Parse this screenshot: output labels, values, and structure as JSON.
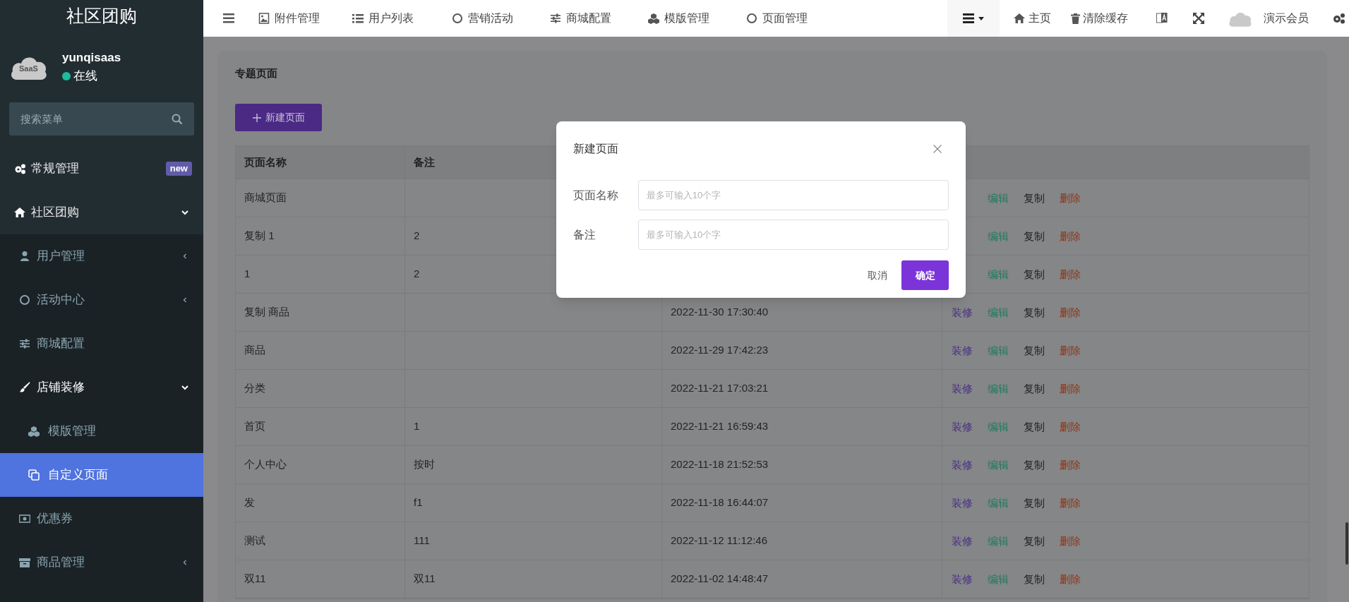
{
  "sidebar": {
    "title": "社区团购",
    "user": {
      "avatar_text": "SaaS",
      "name": "yunqisaas",
      "status": "在线",
      "online": true
    },
    "search": {
      "placeholder": "搜索菜单"
    },
    "menu": [
      {
        "label": "常规管理",
        "badge": "new",
        "selected": false
      },
      {
        "label": "社区团购",
        "expanded": true,
        "selected": false,
        "children": [
          {
            "label": "用户管理",
            "expanded": false,
            "selected": false
          },
          {
            "label": "活动中心",
            "expanded": false,
            "selected": false
          },
          {
            "label": "商城配置",
            "selected": false
          },
          {
            "label": "店铺装修",
            "expanded": true,
            "selected": false,
            "children": [
              {
                "label": "模版管理",
                "selected": false
              },
              {
                "label": "自定义页面",
                "selected": true
              }
            ]
          },
          {
            "label": "优惠券",
            "selected": false
          },
          {
            "label": "商品管理",
            "expanded": false,
            "selected": false
          }
        ]
      }
    ]
  },
  "topbar": {
    "nav": [
      "附件管理",
      "用户列表",
      "营销活动",
      "商城配置",
      "模版管理",
      "页面管理"
    ],
    "home": "主页",
    "clear_cache": "清除缓存",
    "user": "演示会员"
  },
  "content": {
    "title": "专题页面",
    "new_button": "新建页面",
    "table": {
      "columns": [
        "页面名称",
        "备注"
      ],
      "rows": [
        {
          "name": "商城页面",
          "actions": [
            {
              "kind": "edit",
              "label": "编辑"
            },
            {
              "kind": "copy",
              "label": "复制"
            },
            {
              "kind": "delete",
              "label": "删除"
            }
          ]
        },
        {
          "name": "复制 1",
          "note": "2",
          "actions": [
            {
              "kind": "edit",
              "label": "编辑"
            },
            {
              "kind": "copy",
              "label": "复制"
            },
            {
              "kind": "delete",
              "label": "删除"
            }
          ]
        },
        {
          "name": "1",
          "note": "2",
          "actions": [
            {
              "kind": "edit",
              "label": "编辑"
            },
            {
              "kind": "copy",
              "label": "复制"
            },
            {
              "kind": "delete",
              "label": "删除"
            }
          ]
        },
        {
          "name": "复制 商品",
          "time": "2022-11-30 17:30:40",
          "actions": [
            {
              "kind": "decorate",
              "label": "装修"
            },
            {
              "kind": "edit",
              "label": "编辑"
            },
            {
              "kind": "copy",
              "label": "复制"
            },
            {
              "kind": "delete",
              "label": "删除"
            }
          ]
        },
        {
          "name": "商品",
          "time": "2022-11-29 17:42:23",
          "actions": [
            {
              "kind": "decorate",
              "label": "装修"
            },
            {
              "kind": "edit",
              "label": "编辑"
            },
            {
              "kind": "copy",
              "label": "复制"
            },
            {
              "kind": "delete",
              "label": "删除"
            }
          ]
        },
        {
          "name": "分类",
          "time": "2022-11-21 17:03:21",
          "actions": [
            {
              "kind": "decorate",
              "label": "装修"
            },
            {
              "kind": "edit",
              "label": "编辑"
            },
            {
              "kind": "copy",
              "label": "复制"
            },
            {
              "kind": "delete",
              "label": "删除"
            }
          ]
        },
        {
          "name": "首页",
          "note": "1",
          "time": "2022-11-21 16:59:43",
          "actions": [
            {
              "kind": "decorate",
              "label": "装修"
            },
            {
              "kind": "edit",
              "label": "编辑"
            },
            {
              "kind": "copy",
              "label": "复制"
            },
            {
              "kind": "delete",
              "label": "删除"
            }
          ]
        },
        {
          "name": "个人中心",
          "note": "按时",
          "time": "2022-11-18 21:52:53",
          "actions": [
            {
              "kind": "decorate",
              "label": "装修"
            },
            {
              "kind": "edit",
              "label": "编辑"
            },
            {
              "kind": "copy",
              "label": "复制"
            },
            {
              "kind": "delete",
              "label": "删除"
            }
          ]
        },
        {
          "name": "发",
          "note": "f1",
          "time": "2022-11-18 16:44:07",
          "actions": [
            {
              "kind": "decorate",
              "label": "装修"
            },
            {
              "kind": "edit",
              "label": "编辑"
            },
            {
              "kind": "copy",
              "label": "复制"
            },
            {
              "kind": "delete",
              "label": "删除"
            }
          ]
        },
        {
          "name": "测试",
          "note": "111",
          "time": "2022-11-12 11:12:46",
          "actions": [
            {
              "kind": "decorate",
              "label": "装修"
            },
            {
              "kind": "edit",
              "label": "编辑"
            },
            {
              "kind": "copy",
              "label": "复制"
            },
            {
              "kind": "delete",
              "label": "删除"
            }
          ]
        },
        {
          "name": "双11",
          "note": "双11",
          "time": "2022-11-02 14:48:47",
          "actions": [
            {
              "kind": "decorate",
              "label": "装修"
            },
            {
              "kind": "edit",
              "label": "编辑"
            },
            {
              "kind": "copy",
              "label": "复制"
            },
            {
              "kind": "delete",
              "label": "删除"
            }
          ]
        }
      ]
    }
  },
  "modal": {
    "title": "新建页面",
    "fields": [
      {
        "label": "页面名称",
        "placeholder": "最多可输入10个字"
      },
      {
        "label": "备注",
        "placeholder": "最多可输入10个字"
      }
    ],
    "cancel": "取消",
    "confirm": "确定"
  }
}
